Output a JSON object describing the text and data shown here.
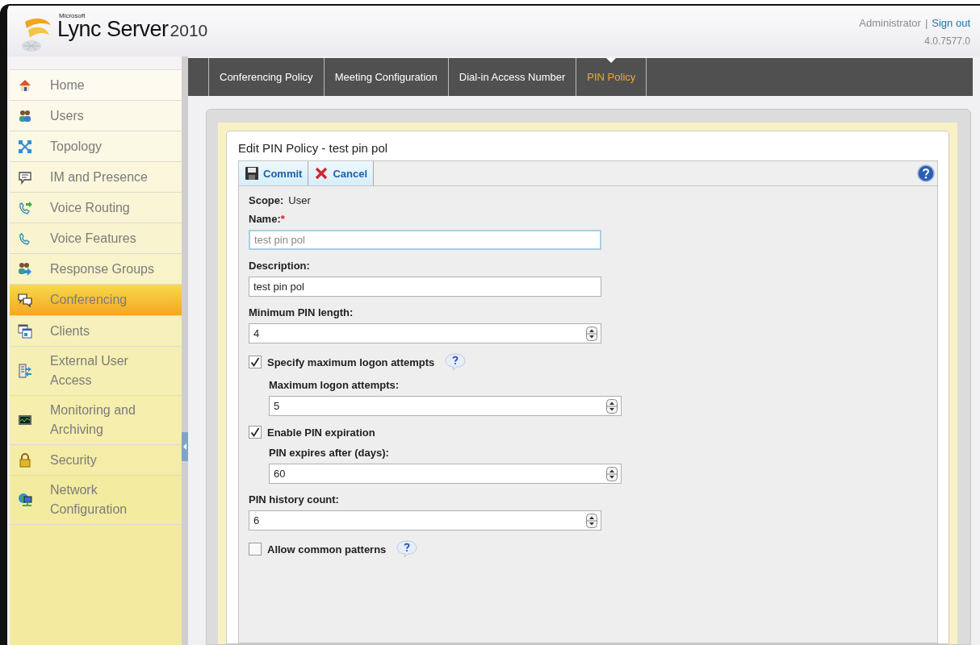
{
  "header": {
    "brand_small": "Microsoft",
    "brand": "Lync Server",
    "brand_year": "2010",
    "user": "Administrator",
    "separator": "|",
    "sign_out": "Sign out",
    "version": "4.0.7577.0"
  },
  "sidebar": {
    "items": [
      {
        "label": "Home",
        "selected": false
      },
      {
        "label": "Users",
        "selected": false
      },
      {
        "label": "Topology",
        "selected": false
      },
      {
        "label": "IM and Presence",
        "selected": false
      },
      {
        "label": "Voice Routing",
        "selected": false
      },
      {
        "label": "Voice Features",
        "selected": false
      },
      {
        "label": "Response Groups",
        "selected": false
      },
      {
        "label": "Conferencing",
        "selected": true
      },
      {
        "label": "Clients",
        "selected": false
      },
      {
        "label": "External User Access",
        "selected": false
      },
      {
        "label": "Monitoring and Archiving",
        "selected": false
      },
      {
        "label": "Security",
        "selected": false
      },
      {
        "label": "Network Configuration",
        "selected": false
      }
    ]
  },
  "tabs": [
    {
      "label": "Conferencing Policy",
      "selected": false
    },
    {
      "label": "Meeting Configuration",
      "selected": false
    },
    {
      "label": "Dial-in Access Number",
      "selected": false
    },
    {
      "label": "PIN Policy",
      "selected": true
    }
  ],
  "panel": {
    "title": "Edit PIN Policy - test pin pol",
    "toolbar": [
      {
        "label": "Commit",
        "kind": "commit"
      },
      {
        "label": "Cancel",
        "kind": "cancel"
      }
    ],
    "fields": [
      {
        "kind": "static",
        "label": "Scope:",
        "value": "User"
      },
      {
        "kind": "text",
        "label": "Name:",
        "required_mark": "*",
        "value": "test pin pol",
        "read_only": true
      },
      {
        "kind": "text",
        "label": "Description:",
        "value": "test pin pol",
        "read_only": false
      },
      {
        "kind": "number",
        "label": "Minimum PIN length:",
        "value": "4"
      },
      {
        "kind": "checkbox",
        "label": "Specify maximum logon attempts",
        "checked": true,
        "help": true,
        "children": [
          {
            "kind": "number",
            "label": "Maximum logon attempts:",
            "value": "5"
          }
        ]
      },
      {
        "kind": "checkbox",
        "label": "Enable PIN expiration",
        "checked": true,
        "help": false,
        "children": [
          {
            "kind": "number",
            "label": "PIN expires after (days):",
            "value": "60"
          }
        ]
      },
      {
        "kind": "number",
        "label": "PIN history count:",
        "value": "6"
      },
      {
        "kind": "checkbox",
        "label": "Allow common patterns",
        "checked": false,
        "help": true
      }
    ]
  }
}
